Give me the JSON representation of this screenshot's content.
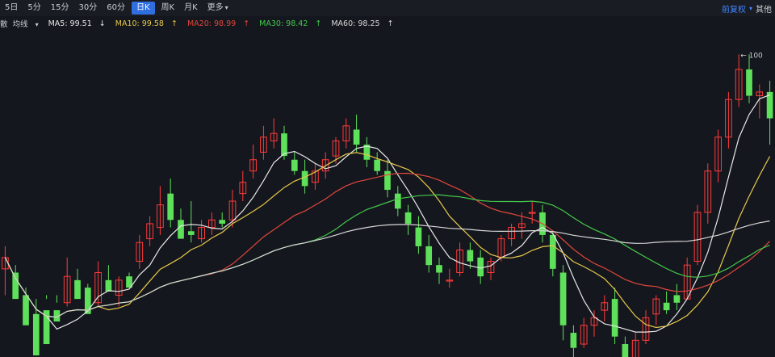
{
  "toolbar": {
    "tabs": [
      {
        "label": "5日",
        "active": false
      },
      {
        "label": "5分",
        "active": false
      },
      {
        "label": "15分",
        "active": false
      },
      {
        "label": "30分",
        "active": false
      },
      {
        "label": "60分",
        "active": false
      },
      {
        "label": "日K",
        "active": true
      },
      {
        "label": "周K",
        "active": false
      },
      {
        "label": "月K",
        "active": false
      },
      {
        "label": "更多",
        "active": false
      }
    ],
    "right_a": "前复权",
    "right_b": "其他"
  },
  "ma_bar": {
    "prefix": "散",
    "indicator": "均线",
    "ma5": "MA5: 99.51",
    "ma5_arrow": "↓",
    "ma10": "MA10: 99.58",
    "ma10_arrow": "↑",
    "ma20": "MA20: 98.99",
    "ma20_arrow": "↑",
    "ma30": "MA30: 98.42",
    "ma30_arrow": "↑",
    "ma60": "MA60: 98.25",
    "ma60_arrow": "↑"
  },
  "colors": {
    "up": "#ff3b3b",
    "down": "#5fe05a",
    "ma5": "#e8e8e8",
    "ma10": "#e6c84a",
    "ma20": "#e0463c",
    "ma30": "#44c94a",
    "ma60": "#d8d8d8",
    "background": "#15171e"
  },
  "chart_data": {
    "type": "candlestick",
    "max_label": "100",
    "ylim": [
      92.0,
      100.5
    ],
    "candles": [
      [
        94.3,
        94.9,
        94.6,
        93.6
      ],
      [
        94.2,
        94.4,
        93.5,
        94.0
      ],
      [
        93.6,
        93.8,
        92.8,
        93.1
      ],
      [
        93.1,
        93.5,
        92.0,
        92.4
      ],
      [
        93.2,
        93.6,
        92.3,
        93.5
      ],
      [
        93.2,
        93.6,
        92.9,
        93.4
      ],
      [
        93.4,
        94.6,
        94.1,
        93.3
      ],
      [
        94.0,
        94.3,
        93.5,
        93.7
      ],
      [
        93.8,
        93.9,
        93.1,
        93.4
      ],
      [
        93.4,
        94.5,
        94.2,
        93.3
      ],
      [
        94.0,
        94.4,
        93.7,
        93.7
      ],
      [
        93.6,
        94.1,
        94.0,
        93.3
      ],
      [
        94.1,
        94.2,
        93.8,
        93.9
      ],
      [
        94.5,
        95.2,
        95.0,
        94.3
      ],
      [
        95.1,
        95.7,
        95.5,
        94.9
      ],
      [
        95.4,
        96.5,
        96.0,
        95.2
      ],
      [
        96.3,
        96.7,
        95.6,
        95.4
      ],
      [
        95.6,
        95.9,
        95.1,
        95.3
      ],
      [
        95.3,
        96.1,
        95.2,
        95.0
      ],
      [
        95.1,
        95.6,
        95.4,
        95.0
      ],
      [
        95.4,
        95.8,
        95.6,
        95.2
      ],
      [
        95.6,
        95.8,
        95.5,
        95.4
      ],
      [
        95.6,
        96.4,
        96.1,
        95.4
      ],
      [
        96.3,
        96.9,
        96.6,
        96.1
      ],
      [
        96.9,
        97.6,
        97.2,
        96.7
      ],
      [
        97.4,
        98.1,
        97.8,
        97.2
      ],
      [
        97.7,
        98.3,
        97.9,
        97.5
      ],
      [
        97.9,
        98.1,
        97.3,
        97.2
      ],
      [
        97.2,
        97.4,
        96.9,
        96.8
      ],
      [
        96.9,
        97.2,
        96.5,
        96.3
      ],
      [
        96.6,
        97.1,
        96.9,
        96.4
      ],
      [
        96.9,
        97.4,
        97.2,
        96.7
      ],
      [
        97.3,
        97.8,
        97.7,
        97.1
      ],
      [
        97.7,
        98.3,
        98.1,
        97.5
      ],
      [
        98.0,
        98.4,
        97.6,
        97.4
      ],
      [
        97.6,
        97.8,
        97.2,
        97.0
      ],
      [
        97.2,
        97.4,
        96.9,
        96.8
      ],
      [
        96.9,
        97.2,
        96.4,
        96.2
      ],
      [
        96.3,
        96.5,
        95.9,
        95.7
      ],
      [
        95.8,
        96.0,
        95.5,
        95.2
      ],
      [
        95.4,
        95.7,
        94.9,
        94.7
      ],
      [
        94.9,
        95.2,
        94.4,
        94.2
      ],
      [
        94.4,
        94.6,
        94.2,
        93.9
      ],
      [
        94.0,
        94.3,
        94.0,
        93.8
      ],
      [
        94.2,
        95.0,
        94.8,
        94.1
      ],
      [
        94.8,
        95.0,
        94.5,
        94.3
      ],
      [
        94.6,
        94.8,
        94.1,
        93.9
      ],
      [
        94.2,
        94.6,
        94.5,
        94.0
      ],
      [
        94.6,
        95.2,
        95.1,
        94.5
      ],
      [
        95.1,
        95.5,
        95.4,
        94.9
      ],
      [
        95.4,
        95.8,
        95.5,
        95.1
      ],
      [
        95.8,
        96.1,
        95.8,
        95.5
      ],
      [
        95.8,
        96.0,
        95.2,
        95.0
      ],
      [
        95.2,
        95.3,
        94.3,
        94.1
      ],
      [
        94.2,
        94.4,
        92.8,
        92.4
      ],
      [
        92.6,
        92.8,
        92.2,
        91.9
      ],
      [
        92.3,
        93.0,
        92.8,
        92.2
      ],
      [
        92.8,
        93.2,
        93.0,
        92.5
      ],
      [
        93.2,
        93.6,
        93.4,
        92.9
      ],
      [
        93.5,
        93.8,
        92.5,
        92.3
      ],
      [
        92.3,
        92.5,
        91.8,
        91.6
      ],
      [
        91.8,
        92.6,
        92.4,
        91.7
      ],
      [
        92.4,
        93.2,
        93.0,
        92.3
      ],
      [
        93.1,
        93.6,
        93.5,
        92.8
      ],
      [
        93.4,
        93.7,
        93.2,
        93.1
      ],
      [
        93.6,
        93.9,
        93.4,
        93.2
      ],
      [
        93.5,
        94.6,
        94.4,
        93.5
      ],
      [
        94.5,
        96.0,
        95.8,
        94.4
      ],
      [
        95.8,
        97.1,
        96.9,
        95.5
      ],
      [
        96.9,
        98.0,
        97.8,
        96.6
      ],
      [
        97.8,
        99.0,
        98.8,
        97.5
      ],
      [
        98.8,
        100.0,
        99.6,
        98.6
      ],
      [
        99.6,
        100.0,
        98.9,
        98.7
      ],
      [
        98.9,
        99.2,
        99.0,
        98.3
      ],
      [
        99.0,
        99.3,
        98.3,
        97.6
      ]
    ],
    "ma": [
      {
        "name": "MA5",
        "period": 5,
        "color_key": "ma5"
      },
      {
        "name": "MA10",
        "period": 10,
        "color_key": "ma10"
      },
      {
        "name": "MA20",
        "period": 20,
        "color_key": "ma20"
      },
      {
        "name": "MA30",
        "period": 30,
        "color_key": "ma30"
      },
      {
        "name": "MA60",
        "period": 60,
        "color_key": "ma60"
      }
    ]
  }
}
